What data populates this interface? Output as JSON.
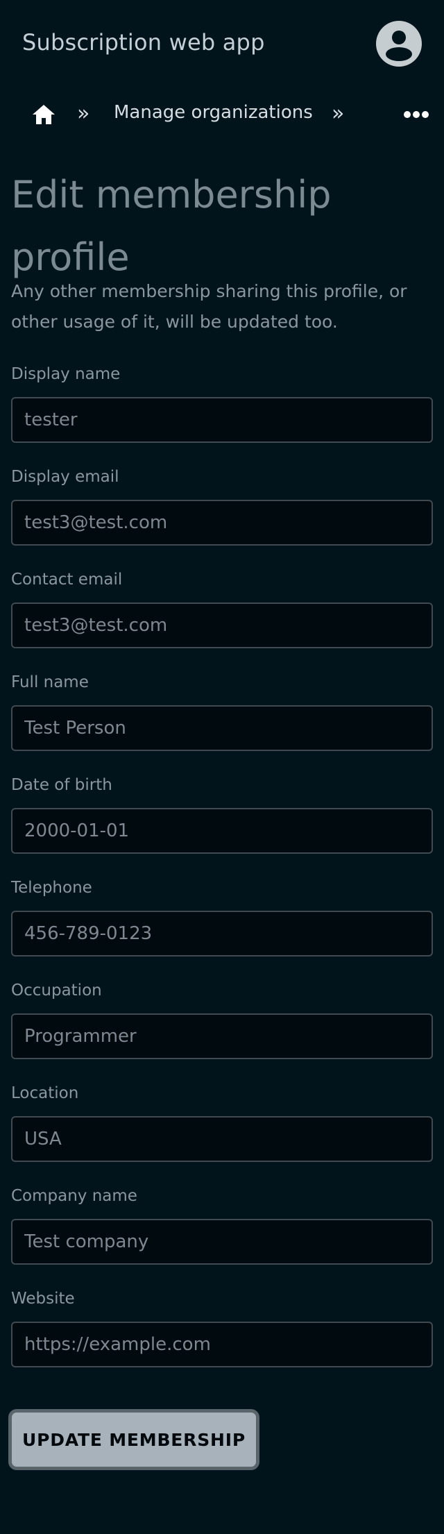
{
  "header": {
    "app_title": "Subscription web app"
  },
  "breadcrumb": {
    "separator": "»",
    "items": [
      "Manage organizations"
    ]
  },
  "page": {
    "title": "Edit membership profile",
    "description": "Any other membership sharing this profile, or other usage of it, will be updated too."
  },
  "form": {
    "fields": [
      {
        "label": "Display name",
        "value": "tester"
      },
      {
        "label": "Display email",
        "value": "test3@test.com"
      },
      {
        "label": "Contact email",
        "value": "test3@test.com"
      },
      {
        "label": "Full name",
        "value": "Test Person"
      },
      {
        "label": "Date of birth",
        "value": "2000-01-01"
      },
      {
        "label": "Telephone",
        "value": "456-789-0123"
      },
      {
        "label": "Occupation",
        "value": "Programmer"
      },
      {
        "label": "Location",
        "value": "USA"
      },
      {
        "label": "Company name",
        "value": "Test company"
      },
      {
        "label": "Website",
        "value": "https://example.com"
      }
    ],
    "submit_label": "UPDATE MEMBERSHIP"
  },
  "colors": {
    "background": "#02141b",
    "button": "#a7b2bb"
  }
}
